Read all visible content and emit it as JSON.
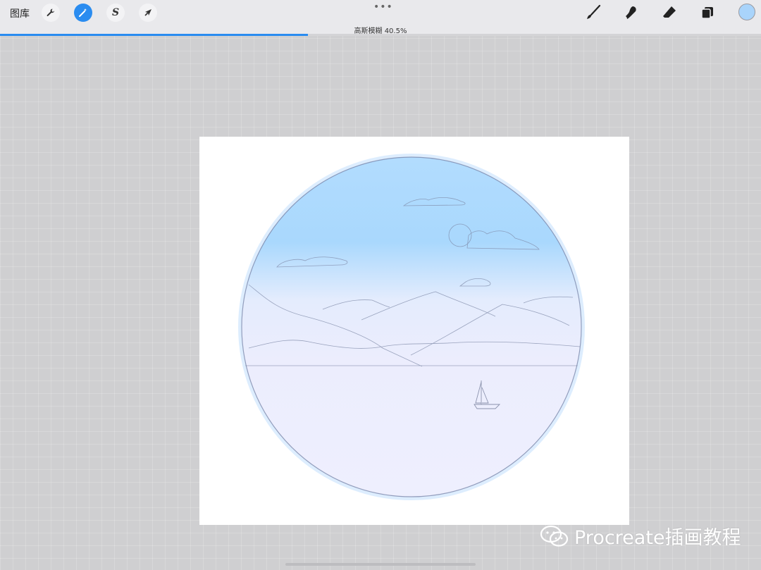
{
  "topbar": {
    "gallery_label": "图库",
    "left_tools": [
      {
        "name": "actions",
        "icon": "wrench-icon",
        "glyph": "🔧"
      },
      {
        "name": "adjustments",
        "icon": "magic-wand-icon",
        "glyph": "✧",
        "active": true
      },
      {
        "name": "selection",
        "icon": "selection-s-icon",
        "glyph": "S"
      },
      {
        "name": "transform",
        "icon": "arrow-cursor-icon",
        "glyph": "➚"
      }
    ],
    "more_dots": "•••",
    "right_tools": [
      {
        "name": "brush",
        "icon": "brush-icon"
      },
      {
        "name": "smudge",
        "icon": "smudge-icon"
      },
      {
        "name": "eraser",
        "icon": "eraser-icon"
      },
      {
        "name": "layers",
        "icon": "layers-icon"
      }
    ],
    "current_color": "#a9d4fb"
  },
  "adjustment": {
    "label": "高斯模糊 40.5%",
    "value_percent": 40.5
  },
  "colors": {
    "accent": "#2a8cf0",
    "sky_top": "#a9d8fd",
    "sea": "#ecedfd"
  },
  "watermark": {
    "text": "Procreate插画教程",
    "icon": "wechat-icon"
  }
}
